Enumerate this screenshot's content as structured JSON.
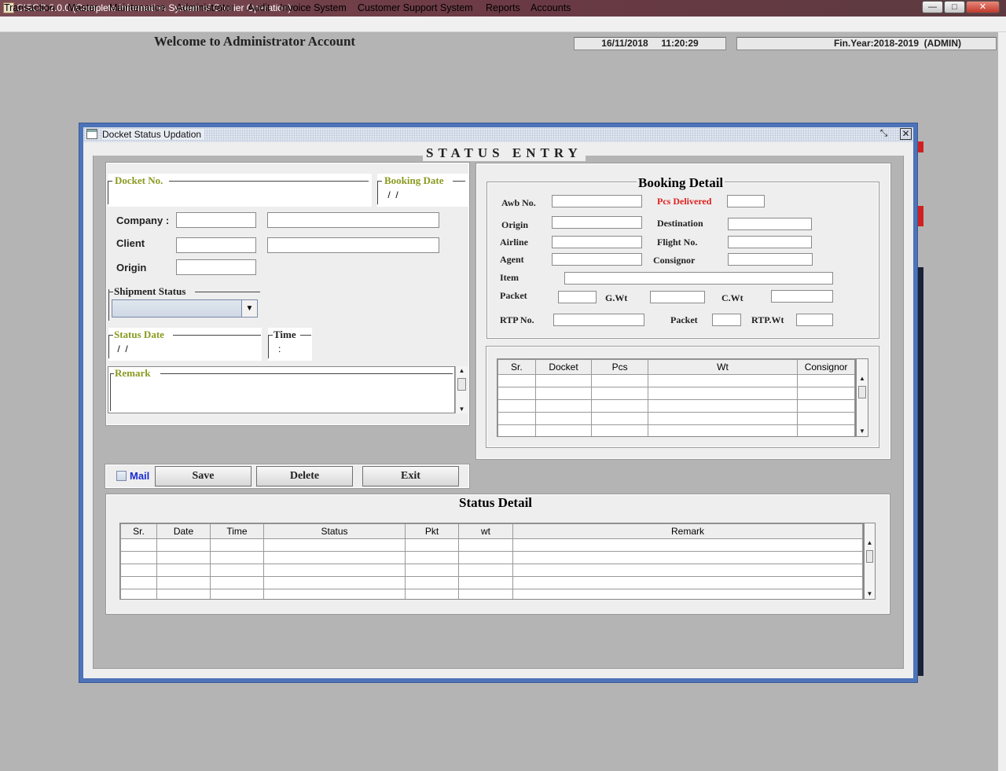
{
  "window": {
    "title": "CISCO 2.0.0 (Complete Information System of Courier Operation)",
    "minimize": "—",
    "maximize": "□",
    "close": "✕"
  },
  "menu": [
    "Transaction",
    "Master",
    "Maintenance",
    "Administrator",
    "Audit",
    "Invoice System",
    "Customer Support System",
    "Reports",
    "Accounts"
  ],
  "header": {
    "welcome": "Welcome to Administrator Account",
    "datetime": "16/11/2018     11:20:29",
    "finyear": "Fin.Year:2018-2019  (ADMIN)"
  },
  "dialog": {
    "title": "Docket Status Updation",
    "heading": "STATUS ENTRY"
  },
  "entry": {
    "docket_no_label": "Docket No.",
    "docket_no_value": "",
    "booking_date_label": "Booking Date",
    "booking_date_value": " /  /",
    "company_label": "Company :",
    "company_code": "",
    "company_name": "",
    "client_label": "Client",
    "client_code": "",
    "client_name": "",
    "origin_label": "Origin",
    "origin_value": "",
    "shipment_status_label": "Shipment Status",
    "shipment_status_value": "",
    "status_date_label": "Status Date",
    "status_date_value": " /  /",
    "time_label": "Time",
    "time_value": ":",
    "remark_label": "Remark",
    "remark_value": ""
  },
  "actions": {
    "mail_label": "Mail",
    "mail_checked": false,
    "save": "Save",
    "delete": "Delete",
    "exit": "Exit"
  },
  "booking": {
    "title": "Booking Detail",
    "awb_no": "Awb No.",
    "pcs_delivered": "Pcs Delivered",
    "origin": "Origin",
    "destination": "Destination",
    "airline": "Airline",
    "flight_no": "Flight No.",
    "agent": "Agent",
    "consignor": "Consignor",
    "item": "Item",
    "packet": "Packet",
    "gwt": "G.Wt",
    "cwt": "C.Wt",
    "rtp_no": "RTP No.",
    "packet2": "Packet",
    "rtp_wt": "RTP.Wt"
  },
  "docket_table": {
    "columns": [
      "Sr.",
      "Docket",
      "Pcs",
      "Wt",
      "Consignor"
    ],
    "rows": [
      [
        "",
        "",
        "",
        "",
        ""
      ],
      [
        "",
        "",
        "",
        "",
        ""
      ],
      [
        "",
        "",
        "",
        "",
        ""
      ],
      [
        "",
        "",
        "",
        "",
        ""
      ],
      [
        "",
        "",
        "",
        "",
        ""
      ]
    ]
  },
  "status_detail": {
    "title": "Status Detail",
    "columns": [
      "Sr.",
      "Date",
      "Time",
      "Status",
      "Pkt",
      "wt",
      "Remark"
    ],
    "rows": [
      [
        "",
        "",
        "",
        "",
        "",
        "",
        ""
      ],
      [
        "",
        "",
        "",
        "",
        "",
        "",
        ""
      ],
      [
        "",
        "",
        "",
        "",
        "",
        "",
        ""
      ],
      [
        "",
        "",
        "",
        "",
        "",
        "",
        ""
      ],
      [
        "",
        "",
        "",
        "",
        "",
        "",
        ""
      ]
    ]
  },
  "colors": {
    "titlebar": "#6b3a44",
    "frame_border": "#4d73b8",
    "label_green": "#8a9a20",
    "label_red": "#e02020",
    "mail_blue": "#1a2ad0"
  }
}
